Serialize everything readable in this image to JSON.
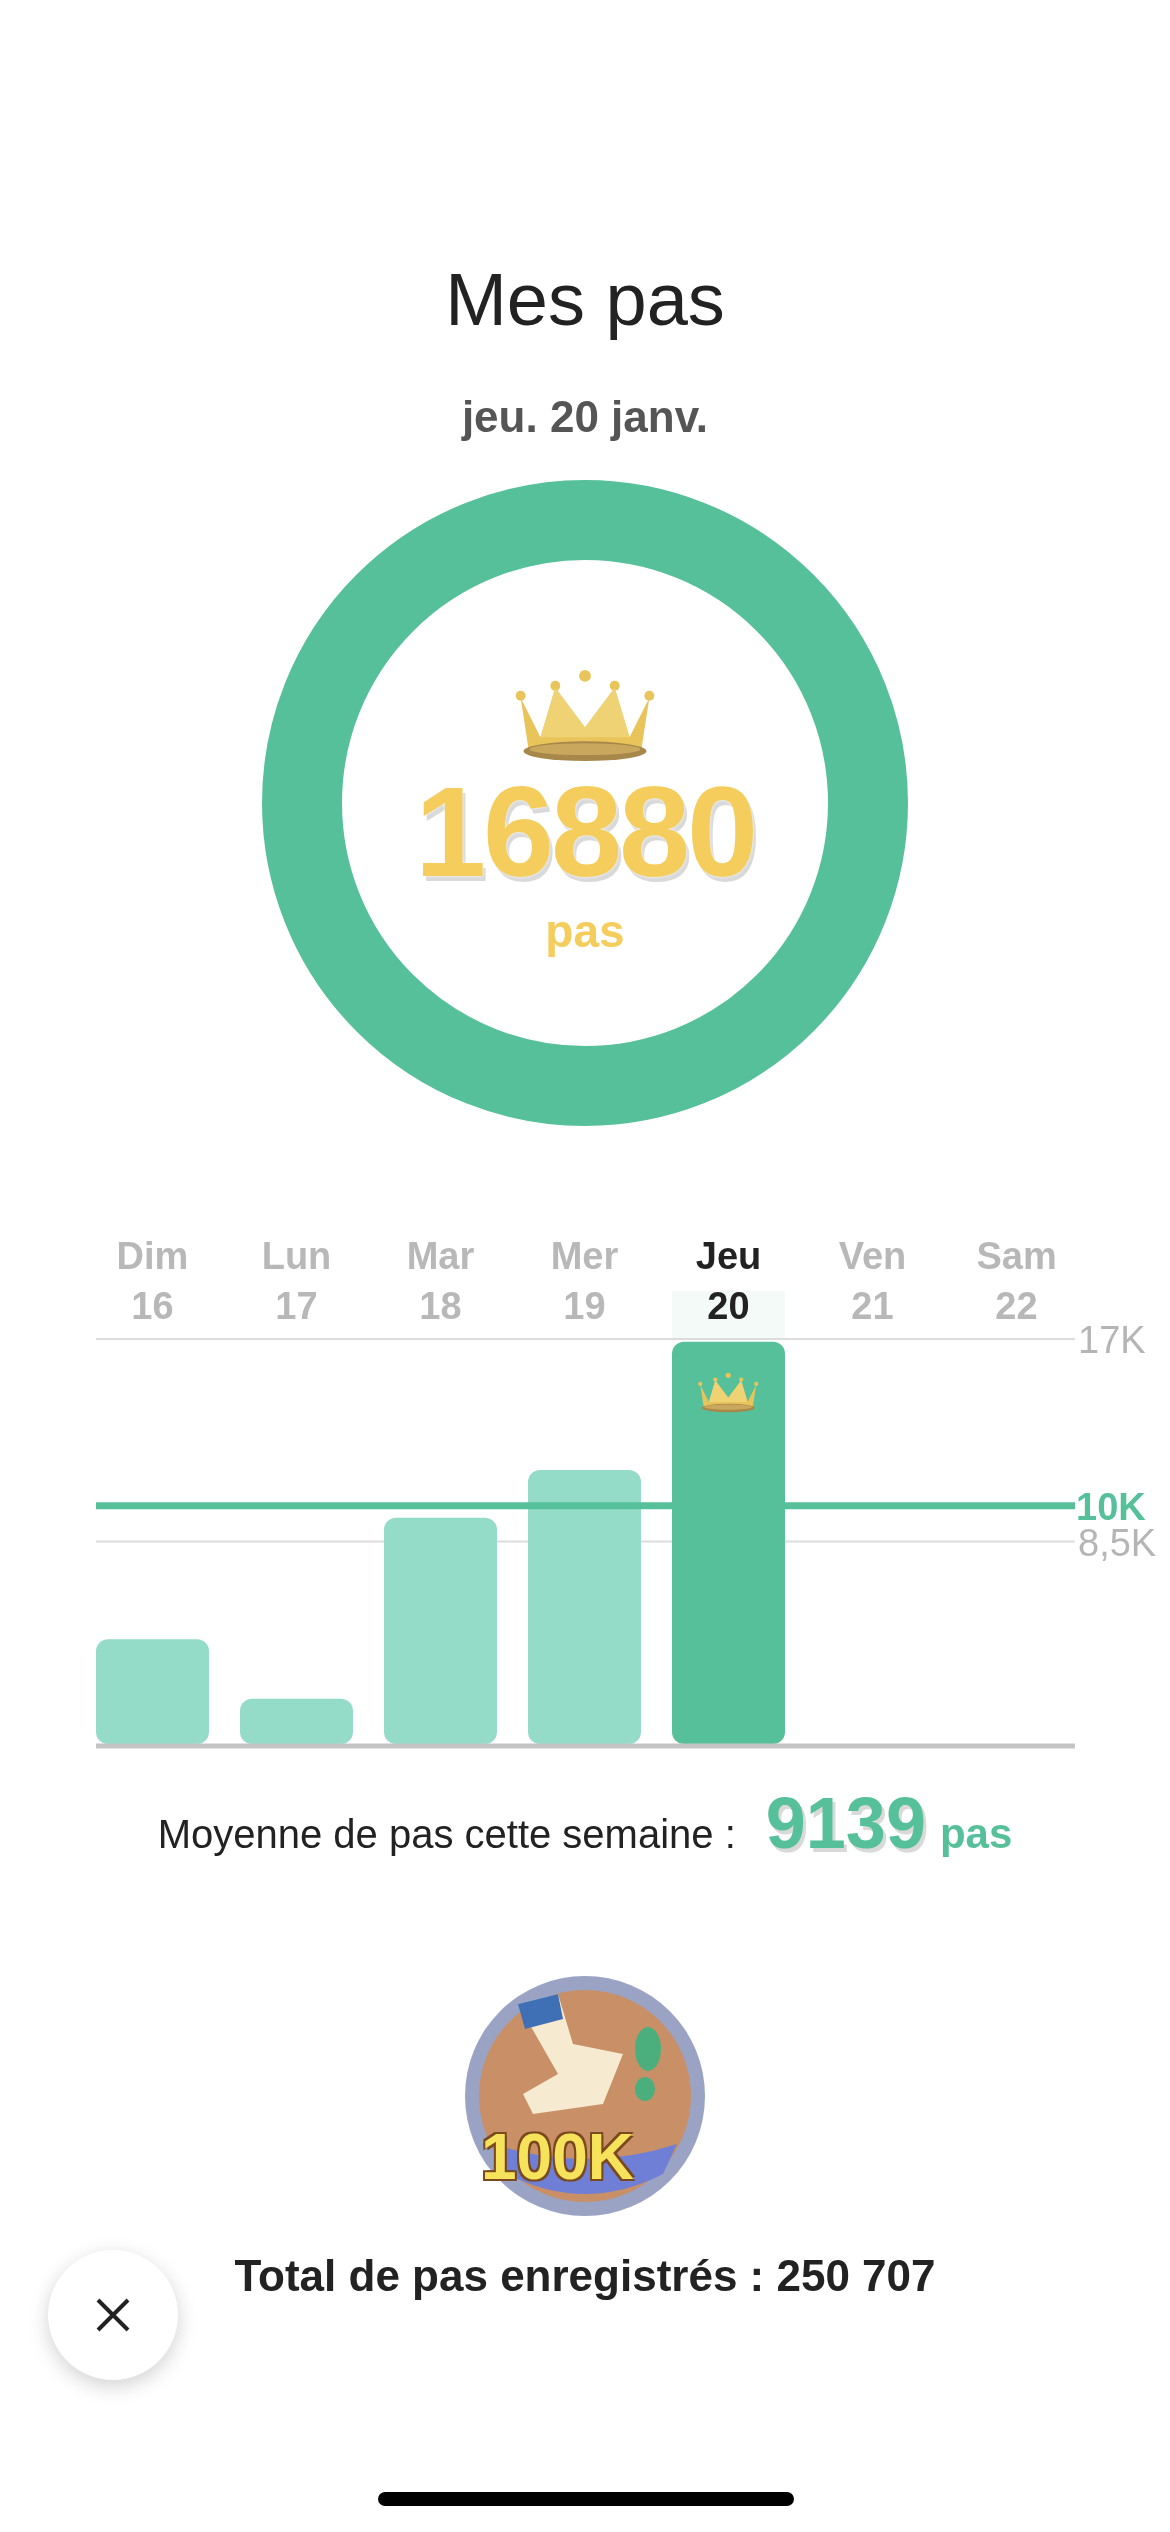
{
  "title": "Mes pas",
  "date": "jeu. 20 janv.",
  "ring": {
    "level": 1,
    "value": "16880",
    "unit": "pas"
  },
  "days": [
    {
      "selected": false
    },
    {
      "selected": false
    },
    {
      "selected": false
    },
    {
      "selected": false
    },
    {
      "selected": true
    },
    {
      "selected": false
    },
    {
      "selected": false
    }
  ],
  "chart_data": {
    "type": "bar",
    "categories": [
      "Dim 16",
      "Lun 17",
      "Mar 18",
      "Mer 19",
      "Jeu 20",
      "Ven 21",
      "Sam 22"
    ],
    "values": [
      4400,
      1900,
      9500,
      11500,
      16880,
      null,
      null
    ],
    "ylim": [
      0,
      17000
    ],
    "yticks": [
      {
        "value": 17000,
        "label": "17K"
      },
      {
        "value": 8500,
        "label": "8,5K"
      }
    ],
    "ref_lines": [
      {
        "axis": "y",
        "value": 10000,
        "label": "10K"
      }
    ]
  },
  "average": {
    "label": "Moyenne de pas cette semaine :",
    "value": "9139",
    "unit": "pas"
  },
  "badge": {
    "label": "100K"
  },
  "total": "Total de pas enregistrés : 250 707"
}
